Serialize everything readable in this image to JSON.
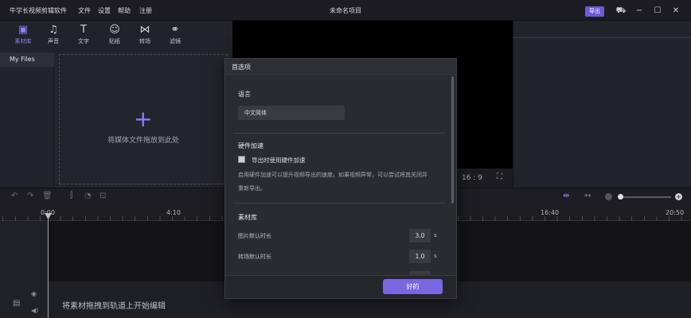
{
  "app": {
    "name": "牛学长视频剪辑软件",
    "window_title": "未命名项目",
    "menu": [
      "文件",
      "设置",
      "帮助",
      "注册"
    ],
    "export_label": "导出"
  },
  "toolbar": {
    "tools": [
      {
        "label": "素材库",
        "icon": "media-library-icon"
      },
      {
        "label": "声音",
        "icon": "music-note-icon"
      },
      {
        "label": "文字",
        "icon": "text-icon"
      },
      {
        "label": "贴纸",
        "icon": "sticker-icon"
      },
      {
        "label": "转场",
        "icon": "transition-icon"
      },
      {
        "label": "滤镜",
        "icon": "filter-icon"
      }
    ]
  },
  "library": {
    "my_files": "My Files",
    "drop_hint": "将媒体文件拖放到此处"
  },
  "preview": {
    "aspect": "16 : 9"
  },
  "timeline": {
    "ticks": [
      "0:00",
      "4:10",
      "16:40",
      "20:50"
    ],
    "track_hint": "将素材拖拽到轨道上开始编辑"
  },
  "dialog": {
    "title": "首选项",
    "language": {
      "heading": "语言",
      "value": "中文简体"
    },
    "hardware": {
      "heading": "硬件加速",
      "checkbox_label": "导出时使用硬件加速",
      "desc_line1": "启用硬件加速可以提升视频导出的速度。如果视频异常，可以尝试将其关闭并",
      "desc_line2": "重新导出。"
    },
    "library": {
      "heading": "素材库",
      "image_duration_label": "图片默认时长",
      "image_duration_value": "3.0",
      "transition_duration_label": "转场默认时长",
      "transition_duration_value": "1.0",
      "unit": "s"
    },
    "ok_label": "好的"
  },
  "colors": {
    "accent": "#7a66e0",
    "background": "#1a1a1f"
  }
}
